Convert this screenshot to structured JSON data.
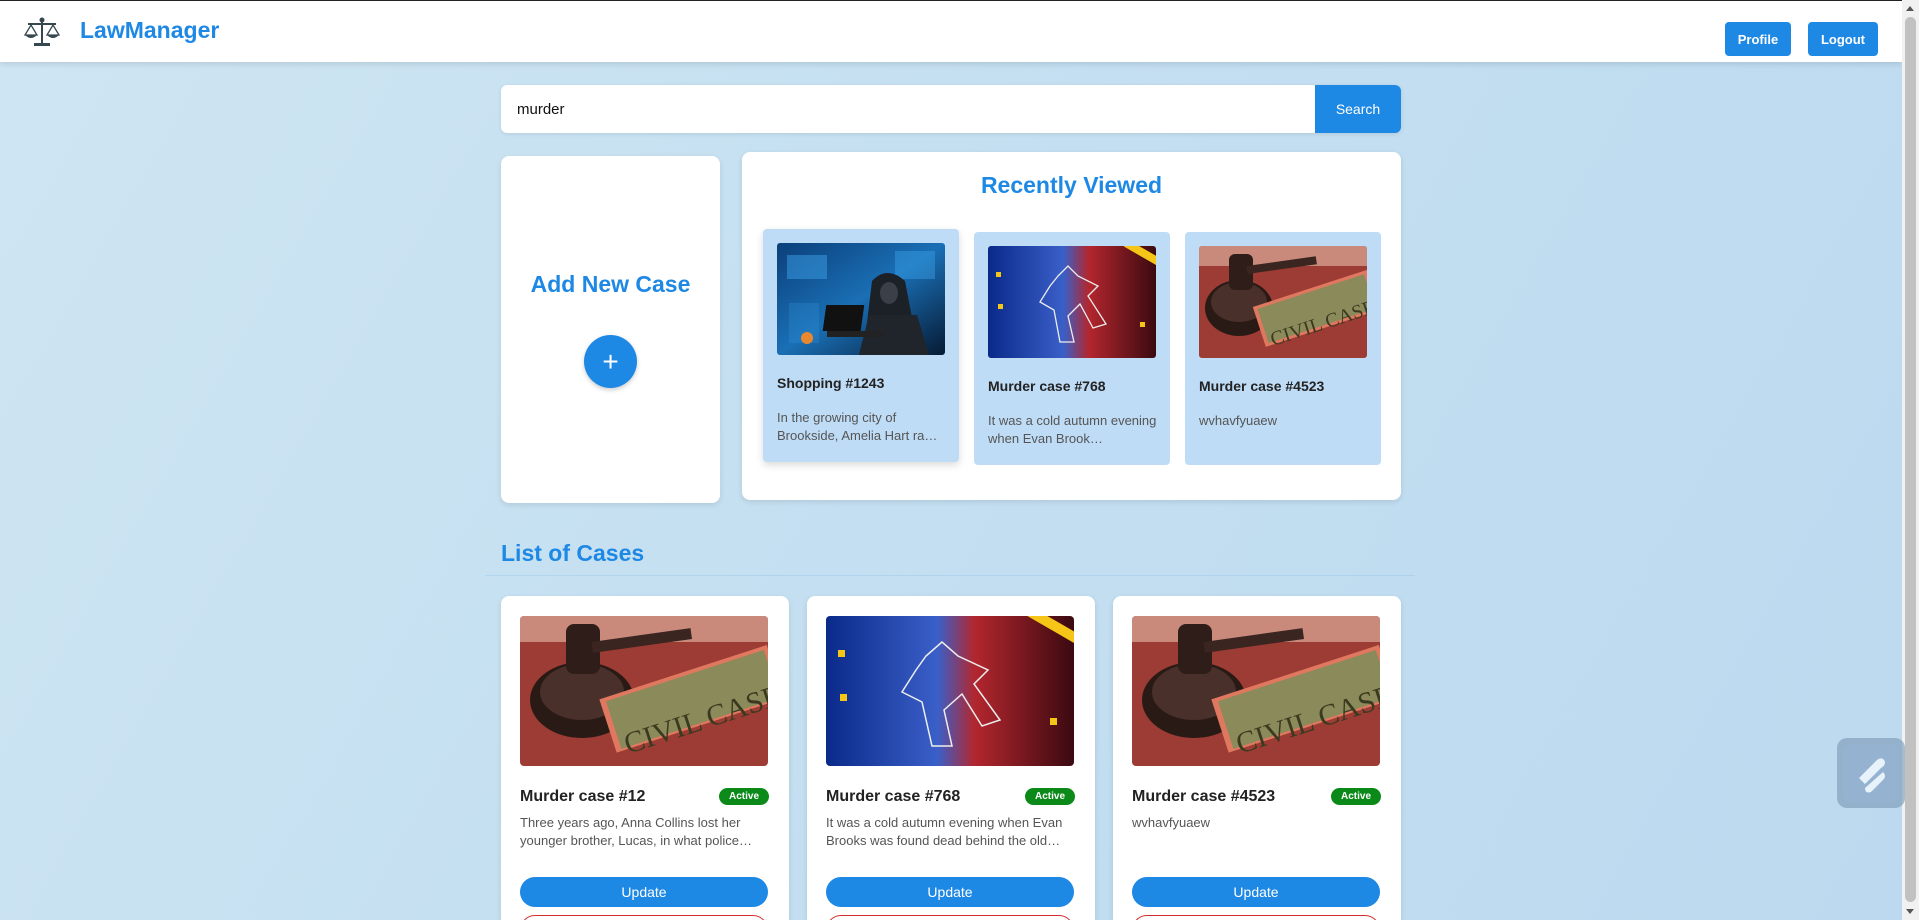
{
  "header": {
    "brand": "LawManager",
    "profile_label": "Profile",
    "logout_label": "Logout",
    "logo_icon": "scales-of-justice-icon"
  },
  "search": {
    "value": "murder",
    "button_label": "Search"
  },
  "add_case": {
    "title": "Add New Case",
    "button_label": "+"
  },
  "recently_viewed": {
    "title": "Recently Viewed",
    "items": [
      {
        "name": "Shopping #1243",
        "description": "In the growing city of Brookside, Amelia Hart ra…",
        "image": "hacker-image"
      },
      {
        "name": "Murder case #768",
        "description": "It was a cold autumn evening when Evan Brook…",
        "image": "crime-scene-image"
      },
      {
        "name": "Murder case #4523",
        "description": "wvhavfyuaew",
        "image": "civil-case-gavel-image"
      }
    ]
  },
  "case_list": {
    "title": "List of Cases",
    "items": [
      {
        "name": "Murder case #12",
        "status": "Active",
        "description": "Three years ago, Anna Collins lost her younger brother, Lucas, in what police…",
        "update_label": "Update",
        "image": "civil-case-gavel-image"
      },
      {
        "name": "Murder case #768",
        "status": "Active",
        "description": "It was a cold autumn evening when Evan Brooks was found dead behind the old…",
        "update_label": "Update",
        "image": "crime-scene-image"
      },
      {
        "name": "Murder case #4523",
        "status": "Active",
        "description": "wvhavfyuaew",
        "update_label": "Update",
        "image": "civil-case-gavel-image"
      }
    ]
  },
  "colors": {
    "accent": "#1e88e5",
    "status_active": "#0b8a1a",
    "delete_border": "#d32f2f"
  }
}
